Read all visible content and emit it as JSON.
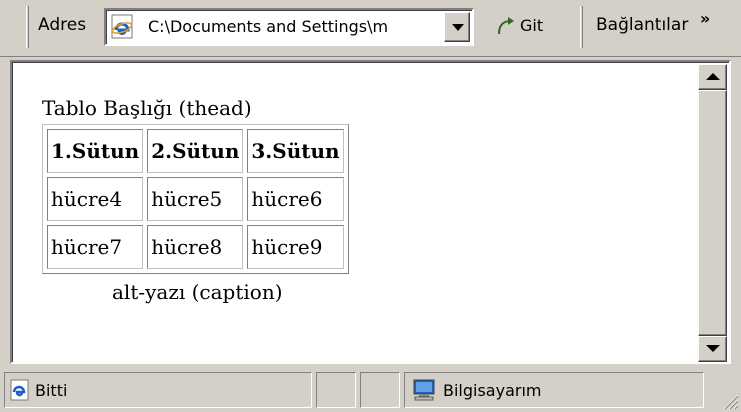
{
  "address_bar": {
    "label": "Adres",
    "url": "C:\\Documents and Settings\\m",
    "go_label": "Git",
    "links_label": "Bağlantılar",
    "more_glyph": "»"
  },
  "page": {
    "thead_title": "Tablo Başlığı (thead)",
    "headers": [
      "1.Sütun",
      "2.Sütun",
      "3.Sütun"
    ],
    "rows": [
      [
        "hücre4",
        "hücre5",
        "hücre6"
      ],
      [
        "hücre7",
        "hücre8",
        "hücre9"
      ]
    ],
    "caption": "alt-yazı (caption)"
  },
  "status_bar": {
    "status_text": "Bitti",
    "zone_text": "Bilgisayarım"
  },
  "icons": {
    "ie_page": "ie-page-icon",
    "go": "go-arrow-icon",
    "zone": "my-computer-icon"
  },
  "colors": {
    "chrome": "#d4d0c8",
    "ie_blue": "#1f5fbf",
    "shadow": "#808080"
  }
}
